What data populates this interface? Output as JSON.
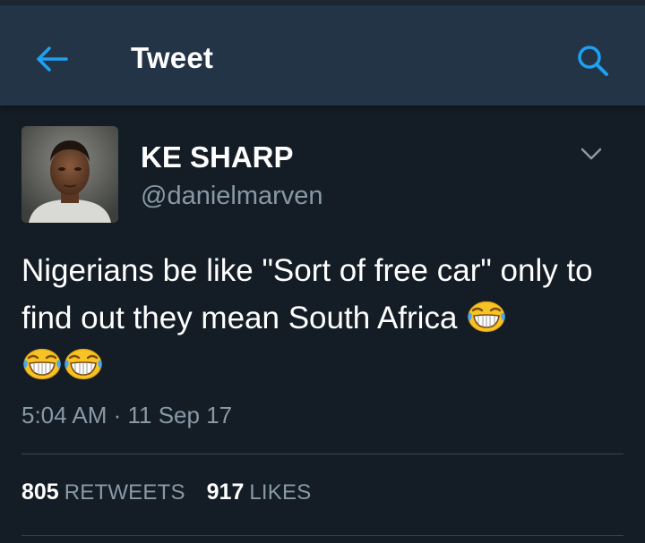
{
  "header": {
    "title": "Tweet",
    "back_icon": "arrow-left-icon",
    "search_icon": "search-icon",
    "accent": "#1da1f2"
  },
  "tweet": {
    "author_name": "KE SHARP",
    "author_handle": "@danielmarven",
    "text": "Nigerians be like \"Sort of free car\" only to find out they mean South Africa",
    "emoji": [
      "face-with-tears-of-joy",
      "face-with-tears-of-joy",
      "face-with-tears-of-joy"
    ],
    "timestamp": "5:04 AM · 11 Sep 17",
    "menu_icon": "chevron-down-icon"
  },
  "stats": {
    "retweets_count": "805",
    "retweets_label": "Retweets",
    "likes_count": "917",
    "likes_label": "Likes"
  },
  "colors": {
    "background": "#141d26",
    "app_bar": "#243447",
    "secondary_text": "#8899a6",
    "divider": "#38444d"
  }
}
